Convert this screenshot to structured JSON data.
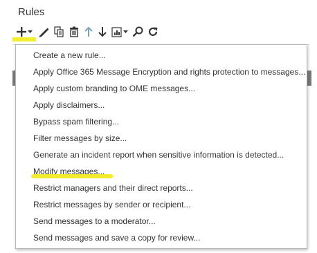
{
  "header": {
    "title": "Rules"
  },
  "toolbar": {
    "icons": [
      "add-icon",
      "edit-icon",
      "copy-icon",
      "delete-icon",
      "move-up-icon",
      "move-down-icon",
      "report-icon",
      "search-icon",
      "refresh-icon"
    ]
  },
  "menu": {
    "items": [
      "Create a new rule...",
      "Apply Office 365 Message Encryption and rights protection to messages...",
      "Apply custom branding to OME messages...",
      "Apply disclaimers...",
      "Bypass spam filtering...",
      "Filter messages by size...",
      "Generate an incident report when sensitive information is detected...",
      "Modify messages...",
      "Restrict managers and their direct reports...",
      "Restrict messages by sender or recipient...",
      "Send messages to a moderator...",
      "Send messages and save a copy for review..."
    ]
  },
  "colors": {
    "highlight": "#f3ef2d",
    "icon": "#333333",
    "icon_disabled": "#7aa3b8"
  }
}
